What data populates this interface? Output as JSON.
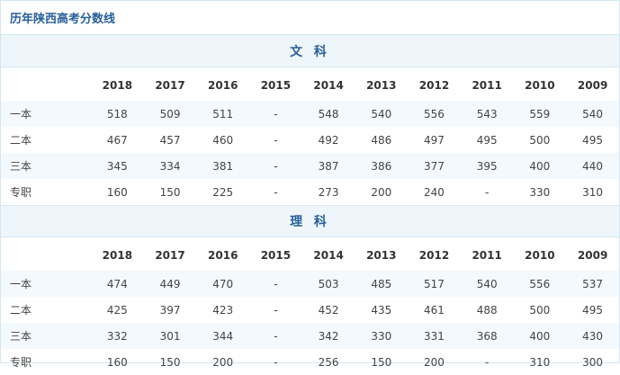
{
  "title": "历年陕西高考分数线",
  "years": [
    "2018",
    "2017",
    "2016",
    "2015",
    "2014",
    "2013",
    "2012",
    "2011",
    "2010",
    "2009"
  ],
  "sections": [
    {
      "name": "文 科",
      "rows": [
        {
          "label": "一本",
          "values": [
            "518",
            "509",
            "511",
            "-",
            "548",
            "540",
            "556",
            "543",
            "559",
            "540"
          ]
        },
        {
          "label": "二本",
          "values": [
            "467",
            "457",
            "460",
            "-",
            "492",
            "486",
            "497",
            "495",
            "500",
            "495"
          ]
        },
        {
          "label": "三本",
          "values": [
            "345",
            "334",
            "381",
            "-",
            "387",
            "386",
            "377",
            "395",
            "400",
            "440"
          ]
        },
        {
          "label": "专职",
          "values": [
            "160",
            "150",
            "225",
            "-",
            "273",
            "200",
            "240",
            "-",
            "330",
            "310"
          ]
        }
      ]
    },
    {
      "name": "理 科",
      "rows": [
        {
          "label": "一本",
          "values": [
            "474",
            "449",
            "470",
            "-",
            "503",
            "485",
            "517",
            "540",
            "556",
            "537"
          ]
        },
        {
          "label": "二本",
          "values": [
            "425",
            "397",
            "423",
            "-",
            "452",
            "435",
            "461",
            "488",
            "500",
            "495"
          ]
        },
        {
          "label": "三本",
          "values": [
            "332",
            "301",
            "344",
            "-",
            "342",
            "330",
            "331",
            "368",
            "400",
            "430"
          ]
        },
        {
          "label": "专职",
          "values": [
            "160",
            "150",
            "200",
            "-",
            "256",
            "150",
            "200",
            "-",
            "310",
            "300"
          ]
        }
      ]
    }
  ]
}
